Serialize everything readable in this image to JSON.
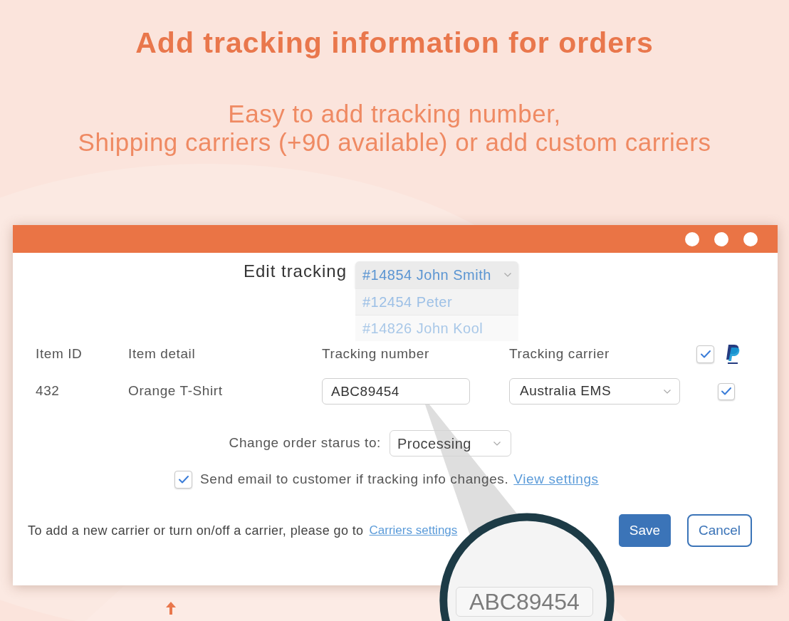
{
  "header": {
    "title": "Add tracking information for orders",
    "subtitle_lines": [
      "Easy to add tracking number,",
      "Shipping carriers (+90 available) or add custom carriers"
    ]
  },
  "edit_tracking": {
    "label": "Edit tracking",
    "order_select": {
      "value": "#14854 John Smith",
      "expanded": true,
      "options": [
        {
          "label": "#12454 Peter",
          "selected": false
        },
        {
          "label": "#14826 John Kool",
          "selected": false
        }
      ]
    }
  },
  "table": {
    "columns": [
      "Item ID",
      "Item detail",
      "Tracking number",
      "Tracking carrier"
    ],
    "select_all": {
      "checked": true
    },
    "rows": [
      {
        "item_id": "432",
        "item_detail": "Orange T-Shirt",
        "tracking_number": "ABC89454",
        "tracking_carrier": "Australia EMS",
        "checked": true
      }
    ]
  },
  "order_status": {
    "label": "Change order starus to:",
    "value": "Processing"
  },
  "email_option": {
    "checked": true,
    "text": "Send email to customer if tracking info changes.",
    "link": "View settings"
  },
  "footer": {
    "text": "To add a new carrier or turn on/off a carrier, please go to",
    "link": "Carriers settings"
  },
  "buttons": [
    {
      "label": "Save",
      "kind": "primary"
    },
    {
      "label": "Cancel",
      "kind": "secondary"
    }
  ],
  "magnifier": {
    "text": "ABC89454"
  }
}
